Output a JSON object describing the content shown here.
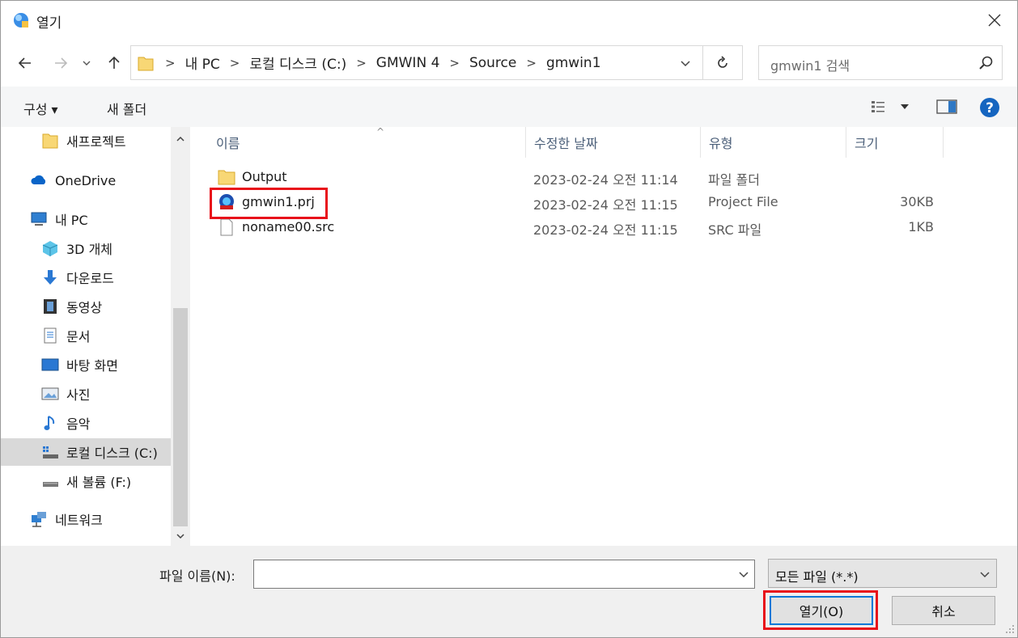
{
  "window": {
    "title": "열기"
  },
  "address": {
    "crumbs": [
      "내 PC",
      "로컬 디스크 (C:)",
      "GMWIN 4",
      "Source",
      "gmwin1"
    ]
  },
  "search": {
    "placeholder": "gmwin1 검색"
  },
  "toolbar": {
    "organize_label": "구성 ▾",
    "new_folder_label": "새 폴더"
  },
  "nav": {
    "items": [
      {
        "label": "새프로젝트",
        "icon": "folder-icon"
      },
      {
        "label": "OneDrive",
        "icon": "cloud-icon"
      },
      {
        "label": "내 PC",
        "icon": "computer-icon"
      },
      {
        "label": "3D 개체",
        "icon": "cube-icon"
      },
      {
        "label": "다운로드",
        "icon": "download-icon"
      },
      {
        "label": "동영상",
        "icon": "video-icon"
      },
      {
        "label": "문서",
        "icon": "document-icon"
      },
      {
        "label": "바탕 화면",
        "icon": "desktop-icon"
      },
      {
        "label": "사진",
        "icon": "picture-icon"
      },
      {
        "label": "음악",
        "icon": "music-icon"
      },
      {
        "label": "로컬 디스크 (C:)",
        "icon": "drive-icon"
      },
      {
        "label": "새 볼륨 (F:)",
        "icon": "drive-icon"
      },
      {
        "label": "네트워크",
        "icon": "network-icon"
      }
    ]
  },
  "columns": {
    "name": "이름",
    "date": "수정한 날짜",
    "type": "유형",
    "size": "크기"
  },
  "files": [
    {
      "name": "Output",
      "date": "2023-02-24 오전 11:14",
      "type": "파일 폴더",
      "size": "",
      "icon": "folder-icon"
    },
    {
      "name": "gmwin1.prj",
      "date": "2023-02-24 오전 11:15",
      "type": "Project File",
      "size": "30KB",
      "icon": "gmwin-project-icon"
    },
    {
      "name": "noname00.src",
      "date": "2023-02-24 오전 11:15",
      "type": "SRC 파일",
      "size": "1KB",
      "icon": "file-icon"
    }
  ],
  "footer": {
    "filename_label": "파일 이름(N):",
    "filename_value": "",
    "filetype_selected": "모든 파일 (*.*)",
    "open_label": "열기(O)",
    "cancel_label": "취소"
  },
  "colors": {
    "highlight": "#e8101a",
    "accent": "#0078d7",
    "folder": "#f8d775"
  }
}
